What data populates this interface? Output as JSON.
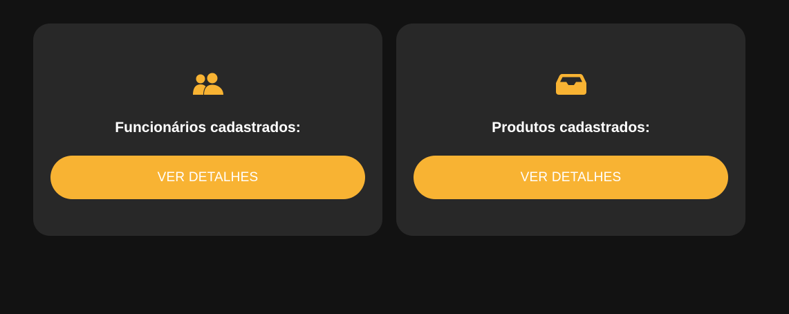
{
  "colors": {
    "background": "#121212",
    "card": "#282828",
    "accent": "#f8b333",
    "text": "#ffffff"
  },
  "cards": [
    {
      "icon": "users-icon",
      "title": "Funcionários cadastrados:",
      "button_label": "VER DETALHES"
    },
    {
      "icon": "inbox-tray-icon",
      "title": "Produtos cadastrados:",
      "button_label": "VER DETALHES"
    }
  ]
}
